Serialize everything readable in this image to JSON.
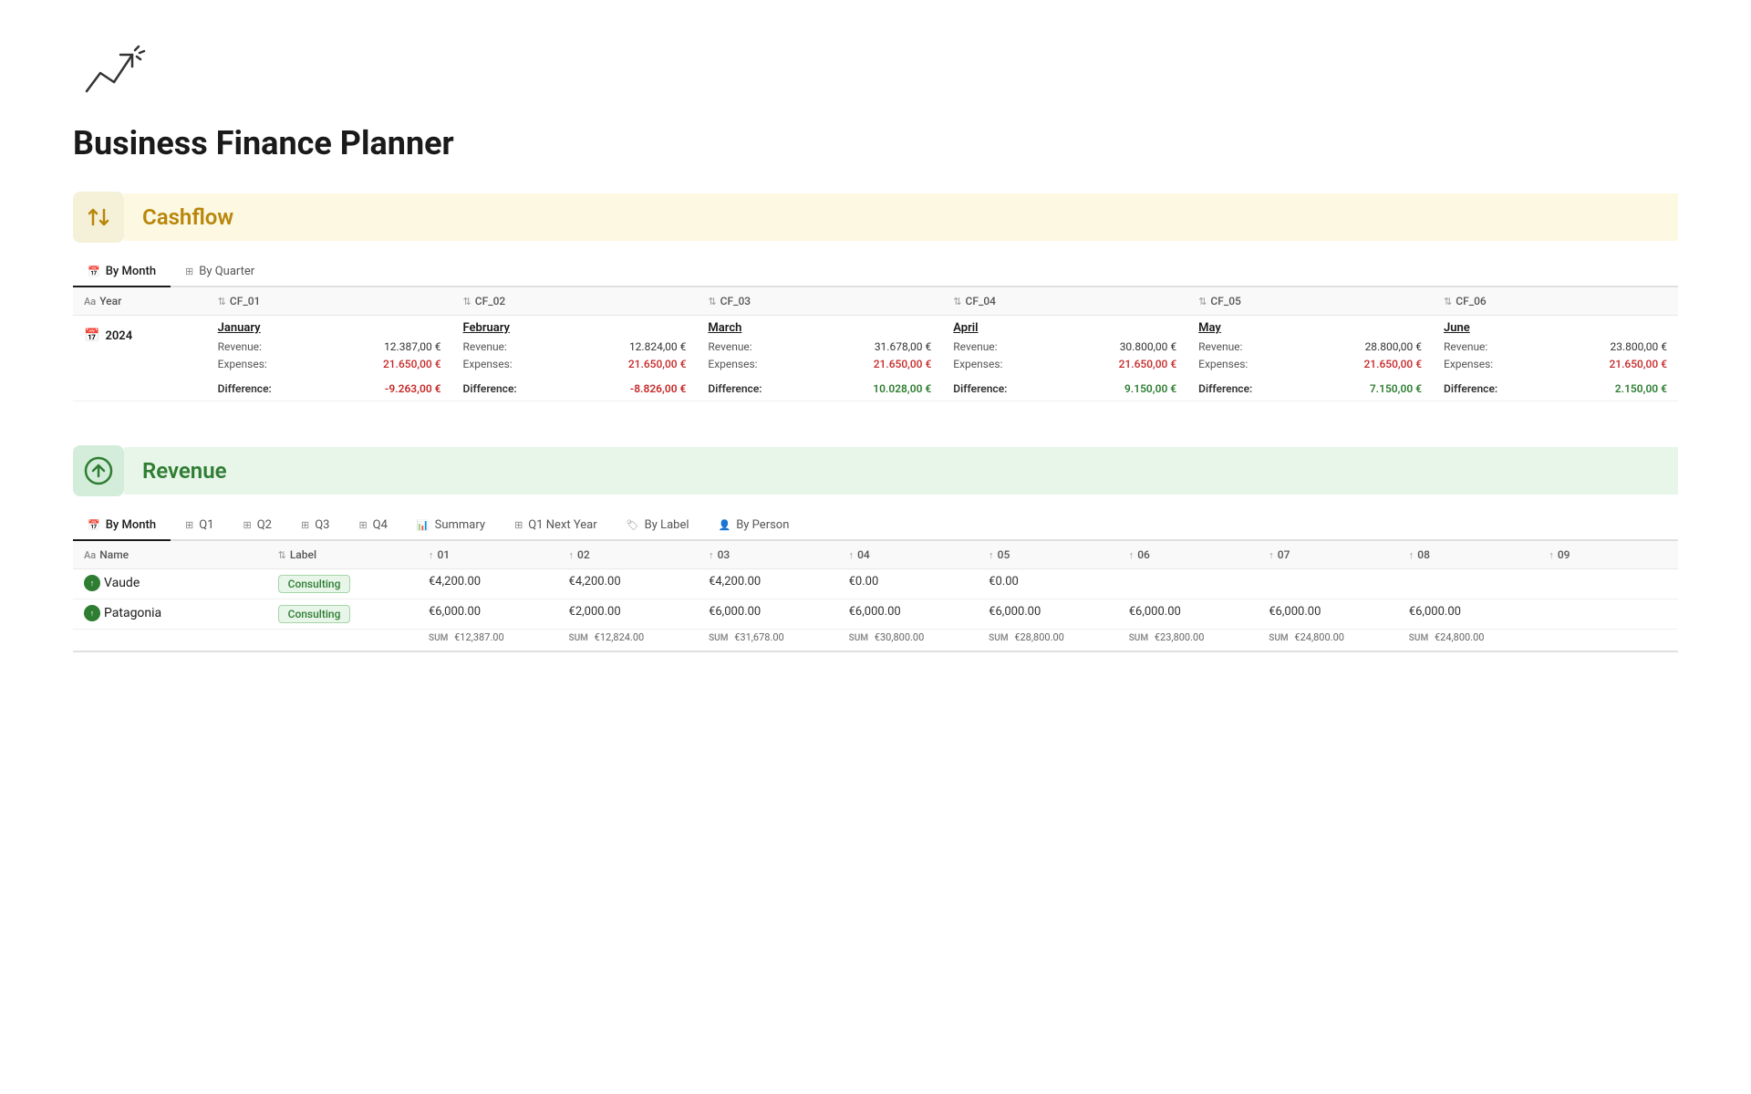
{
  "app": {
    "title": "Business Finance Planner",
    "logo_emoji": "📈"
  },
  "cashflow": {
    "section_title": "Cashflow",
    "tabs": [
      {
        "label": "By Month",
        "active": true,
        "icon": "calendar"
      },
      {
        "label": "By Quarter",
        "active": false,
        "icon": "grid"
      }
    ],
    "table": {
      "columns": [
        {
          "key": "year",
          "label": "Year",
          "icon": "Aa"
        },
        {
          "key": "cf01",
          "label": "CF_01",
          "icon": "sort"
        },
        {
          "key": "cf02",
          "label": "CF_02",
          "icon": "sort"
        },
        {
          "key": "cf03",
          "label": "CF_03",
          "icon": "sort"
        },
        {
          "key": "cf04",
          "label": "CF_04",
          "icon": "sort"
        },
        {
          "key": "cf05",
          "label": "CF_05",
          "icon": "sort"
        },
        {
          "key": "cf06",
          "label": "CF_06",
          "icon": "sort"
        }
      ],
      "rows": [
        {
          "year": "2024",
          "months": [
            {
              "name": "January",
              "revenue_label": "Revenue:",
              "revenue_value": "12.387,00 €",
              "expenses_label": "Expenses:",
              "expenses_value": "21.650,00 €",
              "diff_label": "Difference:",
              "diff_value": "-9.263,00 €",
              "diff_positive": false
            },
            {
              "name": "February",
              "revenue_label": "Revenue:",
              "revenue_value": "12.824,00 €",
              "expenses_label": "Expenses:",
              "expenses_value": "21.650,00 €",
              "diff_label": "Difference:",
              "diff_value": "-8.826,00 €",
              "diff_positive": false
            },
            {
              "name": "March",
              "revenue_label": "Revenue:",
              "revenue_value": "31.678,00 €",
              "expenses_label": "Expenses:",
              "expenses_value": "21.650,00 €",
              "diff_label": "Difference:",
              "diff_value": "10.028,00 €",
              "diff_positive": true
            },
            {
              "name": "April",
              "revenue_label": "Revenue:",
              "revenue_value": "30.800,00 €",
              "expenses_label": "Expenses:",
              "expenses_value": "21.650,00 €",
              "diff_label": "Difference:",
              "diff_value": "9.150,00 €",
              "diff_positive": true
            },
            {
              "name": "May",
              "revenue_label": "Revenue:",
              "revenue_value": "28.800,00 €",
              "expenses_label": "Expenses:",
              "expenses_value": "21.650,00 €",
              "diff_label": "Difference:",
              "diff_value": "7.150,00 €",
              "diff_positive": true
            },
            {
              "name": "June",
              "revenue_label": "Revenue:",
              "revenue_value": "23.800,00 €",
              "expenses_label": "Expenses:",
              "expenses_value": "21.650,00 €",
              "diff_label": "Difference:",
              "diff_value": "2.150,00 €",
              "diff_positive": true
            }
          ]
        }
      ]
    }
  },
  "revenue": {
    "section_title": "Revenue",
    "tabs": [
      {
        "label": "By Month",
        "active": true,
        "icon": "calendar"
      },
      {
        "label": "Q1",
        "active": false,
        "icon": "grid"
      },
      {
        "label": "Q2",
        "active": false,
        "icon": "grid"
      },
      {
        "label": "Q3",
        "active": false,
        "icon": "grid"
      },
      {
        "label": "Q4",
        "active": false,
        "icon": "grid"
      },
      {
        "label": "Summary",
        "active": false,
        "icon": "chart"
      },
      {
        "label": "Q1 Next Year",
        "active": false,
        "icon": "grid"
      },
      {
        "label": "By Label",
        "active": false,
        "icon": "tag"
      },
      {
        "label": "By Person",
        "active": false,
        "icon": "person"
      }
    ],
    "table": {
      "columns": [
        {
          "key": "name",
          "label": "Name",
          "icon": "Aa"
        },
        {
          "key": "label",
          "label": "Label",
          "icon": "arrow"
        },
        {
          "key": "01",
          "label": "01",
          "icon": "arrow"
        },
        {
          "key": "02",
          "label": "02",
          "icon": "arrow"
        },
        {
          "key": "03",
          "label": "03",
          "icon": "arrow"
        },
        {
          "key": "04",
          "label": "04",
          "icon": "arrow"
        },
        {
          "key": "05",
          "label": "05",
          "icon": "arrow"
        },
        {
          "key": "06",
          "label": "06",
          "icon": "arrow"
        },
        {
          "key": "07",
          "label": "07",
          "icon": "arrow"
        },
        {
          "key": "08",
          "label": "08",
          "icon": "arrow"
        },
        {
          "key": "09",
          "label": "09",
          "icon": "arrow"
        }
      ],
      "rows": [
        {
          "name": "Vaude",
          "label": "Consulting",
          "v01": "€4,200.00",
          "v02": "€4,200.00",
          "v03": "€4,200.00",
          "v04": "€0.00",
          "v05": "€0.00",
          "v06": "",
          "v07": "",
          "v08": "",
          "v09": ""
        },
        {
          "name": "Patagonia",
          "label": "Consulting",
          "v01": "€6,000.00",
          "v02": "€2,000.00",
          "v03": "€6,000.00",
          "v04": "€6,000.00",
          "v05": "€6,000.00",
          "v06": "€6,000.00",
          "v07": "€6,000.00",
          "v08": "€6,000.00",
          "v09": ""
        }
      ],
      "sum_row": {
        "label": "SUM",
        "v01": "€12,387.00",
        "v02": "€12,824.00",
        "v03": "€31,678.00",
        "v04": "€30,800.00",
        "v05": "€28,800.00",
        "v06": "€23,800.00",
        "v07": "€24,800.00",
        "v08": "€24,800.00",
        "v09": ""
      }
    }
  }
}
